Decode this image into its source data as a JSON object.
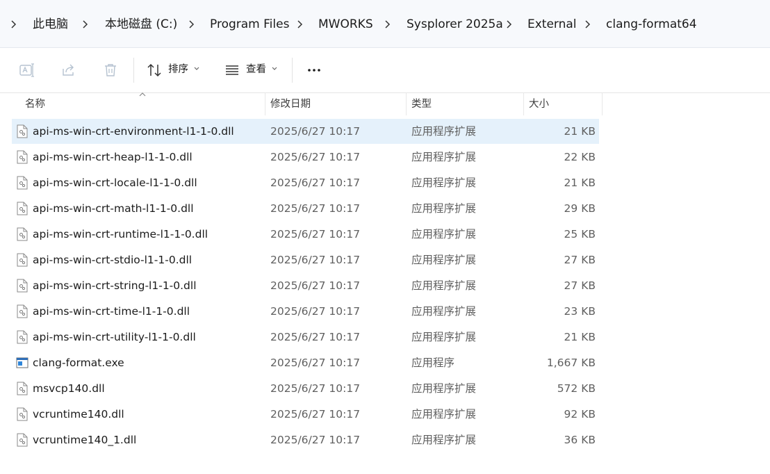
{
  "breadcrumb": {
    "segments": [
      "此电脑",
      "本地磁盘 (C:)",
      "Program Files",
      "MWORKS",
      "Sysplorer 2025a",
      "External",
      "clang-format64"
    ]
  },
  "toolbar": {
    "rename_icon": "rename-icon",
    "share_icon": "share-icon",
    "delete_icon": "trash-icon",
    "sort_label": "排序",
    "view_label": "查看",
    "more_icon": "more-icon"
  },
  "columns": {
    "name": "名称",
    "date": "修改日期",
    "type": "类型",
    "size": "大小"
  },
  "files": [
    {
      "name": "api-ms-win-crt-environment-l1-1-0.dll",
      "date": "2025/6/27 10:17",
      "type": "应用程序扩展",
      "size": "21 KB",
      "icon": "dll-file-icon",
      "selected": true
    },
    {
      "name": "api-ms-win-crt-heap-l1-1-0.dll",
      "date": "2025/6/27 10:17",
      "type": "应用程序扩展",
      "size": "22 KB",
      "icon": "dll-file-icon"
    },
    {
      "name": "api-ms-win-crt-locale-l1-1-0.dll",
      "date": "2025/6/27 10:17",
      "type": "应用程序扩展",
      "size": "21 KB",
      "icon": "dll-file-icon"
    },
    {
      "name": "api-ms-win-crt-math-l1-1-0.dll",
      "date": "2025/6/27 10:17",
      "type": "应用程序扩展",
      "size": "29 KB",
      "icon": "dll-file-icon"
    },
    {
      "name": "api-ms-win-crt-runtime-l1-1-0.dll",
      "date": "2025/6/27 10:17",
      "type": "应用程序扩展",
      "size": "25 KB",
      "icon": "dll-file-icon"
    },
    {
      "name": "api-ms-win-crt-stdio-l1-1-0.dll",
      "date": "2025/6/27 10:17",
      "type": "应用程序扩展",
      "size": "27 KB",
      "icon": "dll-file-icon"
    },
    {
      "name": "api-ms-win-crt-string-l1-1-0.dll",
      "date": "2025/6/27 10:17",
      "type": "应用程序扩展",
      "size": "27 KB",
      "icon": "dll-file-icon"
    },
    {
      "name": "api-ms-win-crt-time-l1-1-0.dll",
      "date": "2025/6/27 10:17",
      "type": "应用程序扩展",
      "size": "23 KB",
      "icon": "dll-file-icon"
    },
    {
      "name": "api-ms-win-crt-utility-l1-1-0.dll",
      "date": "2025/6/27 10:17",
      "type": "应用程序扩展",
      "size": "21 KB",
      "icon": "dll-file-icon"
    },
    {
      "name": "clang-format.exe",
      "date": "2025/6/27 10:17",
      "type": "应用程序",
      "size": "1,667 KB",
      "icon": "exe-file-icon"
    },
    {
      "name": "msvcp140.dll",
      "date": "2025/6/27 10:17",
      "type": "应用程序扩展",
      "size": "572 KB",
      "icon": "dll-file-icon"
    },
    {
      "name": "vcruntime140.dll",
      "date": "2025/6/27 10:17",
      "type": "应用程序扩展",
      "size": "92 KB",
      "icon": "dll-file-icon"
    },
    {
      "name": "vcruntime140_1.dll",
      "date": "2025/6/27 10:17",
      "type": "应用程序扩展",
      "size": "36 KB",
      "icon": "dll-file-icon"
    }
  ],
  "colors": {
    "selection": "#e5f1fb",
    "address_bar": "#f7f9fc",
    "muted_text": "#5f5f5f"
  }
}
